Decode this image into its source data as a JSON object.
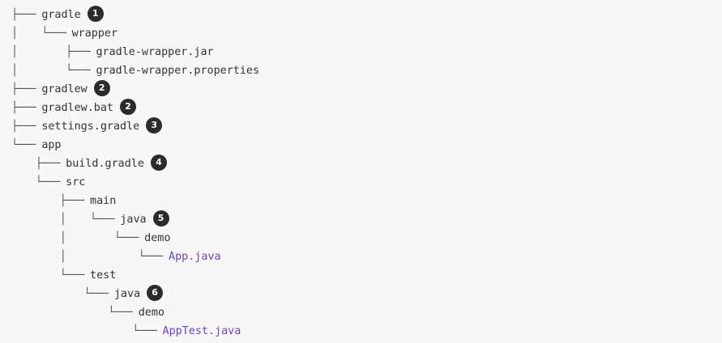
{
  "tree": {
    "lines": [
      {
        "prefix": "├─── ",
        "name": "gradle",
        "badge": "1",
        "kind": "dir"
      },
      {
        "prefix": "│    └─── ",
        "name": "wrapper",
        "badge": "",
        "kind": "dir"
      },
      {
        "prefix": "│        ├─── ",
        "name": "gradle-wrapper.jar",
        "badge": "",
        "kind": "file"
      },
      {
        "prefix": "│        └─── ",
        "name": "gradle-wrapper.properties",
        "badge": "",
        "kind": "file"
      },
      {
        "prefix": "├─── ",
        "name": "gradlew",
        "badge": "2",
        "kind": "file"
      },
      {
        "prefix": "├─── ",
        "name": "gradlew.bat",
        "badge": "2",
        "kind": "file"
      },
      {
        "prefix": "├─── ",
        "name": "settings.gradle",
        "badge": "3",
        "kind": "file"
      },
      {
        "prefix": "└─── ",
        "name": "app",
        "badge": "",
        "kind": "dir"
      },
      {
        "prefix": "    ├─── ",
        "name": "build.gradle",
        "badge": "4",
        "kind": "file"
      },
      {
        "prefix": "    └─── ",
        "name": "src",
        "badge": "",
        "kind": "dir"
      },
      {
        "prefix": "        ├─── ",
        "name": "main",
        "badge": "",
        "kind": "dir"
      },
      {
        "prefix": "        │    └─── ",
        "name": "java",
        "badge": "5",
        "kind": "dir"
      },
      {
        "prefix": "        │        └─── ",
        "name": "demo",
        "badge": "",
        "kind": "dir"
      },
      {
        "prefix": "        │            └─── ",
        "name": "App.java",
        "badge": "",
        "kind": "java"
      },
      {
        "prefix": "        └─── ",
        "name": "test",
        "badge": "",
        "kind": "dir"
      },
      {
        "prefix": "            └─── ",
        "name": "java",
        "badge": "6",
        "kind": "dir"
      },
      {
        "prefix": "                └─── ",
        "name": "demo",
        "badge": "",
        "kind": "dir"
      },
      {
        "prefix": "                    └─── ",
        "name": "AppTest.java",
        "badge": "",
        "kind": "java"
      }
    ]
  }
}
